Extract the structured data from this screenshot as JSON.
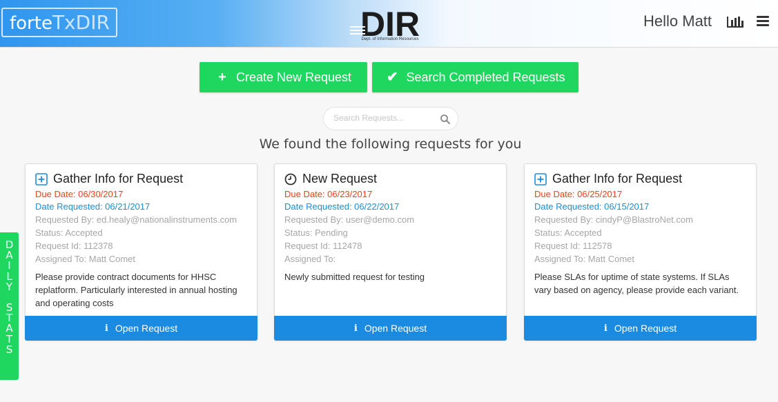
{
  "header": {
    "brand_part1": "forte",
    "brand_part2": "TxDIR",
    "logo_text": "DIR",
    "logo_subtitle": "Dept. of Information Resources",
    "greeting": "Hello Matt",
    "stats_icon": "bar-chart-icon",
    "menu_icon": "hamburger-menu-icon"
  },
  "actions": {
    "create_label": "Create New Request",
    "search_completed_label": "Search Completed Requests"
  },
  "search": {
    "placeholder": "Search Requests..."
  },
  "found_text": "We found the following requests for you",
  "cards": [
    {
      "title": "Gather Info for Request",
      "icon": "plus-square-icon",
      "due": "Due Date: 06/30/2017",
      "requested": "Date Requested: 06/21/2017",
      "requested_by": "Requested By: ed.healy@nationalinstruments.com",
      "status": "Status: Accepted",
      "request_id": "Request Id: 112378",
      "assigned_to": "Assigned To: Matt Comet",
      "description": "Please provide contract documents for HHSC replatform. Particularly interested in annual hosting and operating costs",
      "open_label": "Open Request"
    },
    {
      "title": "New Request",
      "icon": "clock-icon",
      "due": "Due Date: 06/23/2017",
      "requested": "Date Requested: 06/22/2017",
      "requested_by": "Requested By: user@demo.com",
      "status": "Status: Pending",
      "request_id": "Request Id: 112478",
      "assigned_to": "Assigned To:",
      "description": "Newly submitted request for testing",
      "open_label": "Open Request"
    },
    {
      "title": "Gather Info for Request",
      "icon": "plus-square-icon",
      "due": "Due Date: 06/25/2017",
      "requested": "Date Requested: 06/15/2017",
      "requested_by": "Requested By: cindyP@BlastroNet.com",
      "status": "Status: Accepted",
      "request_id": "Request Id: 112578",
      "assigned_to": "Assigned To: Matt Comet",
      "description": "Please SLAs for uptime of state systems. If SLAs vary based on agency, please provide each variant.",
      "open_label": "Open Request"
    }
  ],
  "daily_stats": {
    "letters": [
      "D",
      "A",
      "I",
      "L",
      "Y",
      "",
      "S",
      "T",
      "A",
      "T",
      "S"
    ]
  },
  "colors": {
    "green": "#1fd75f",
    "blue": "#1a8be0",
    "due_red": "#e8421f",
    "requested_blue": "#1a8fd6"
  }
}
